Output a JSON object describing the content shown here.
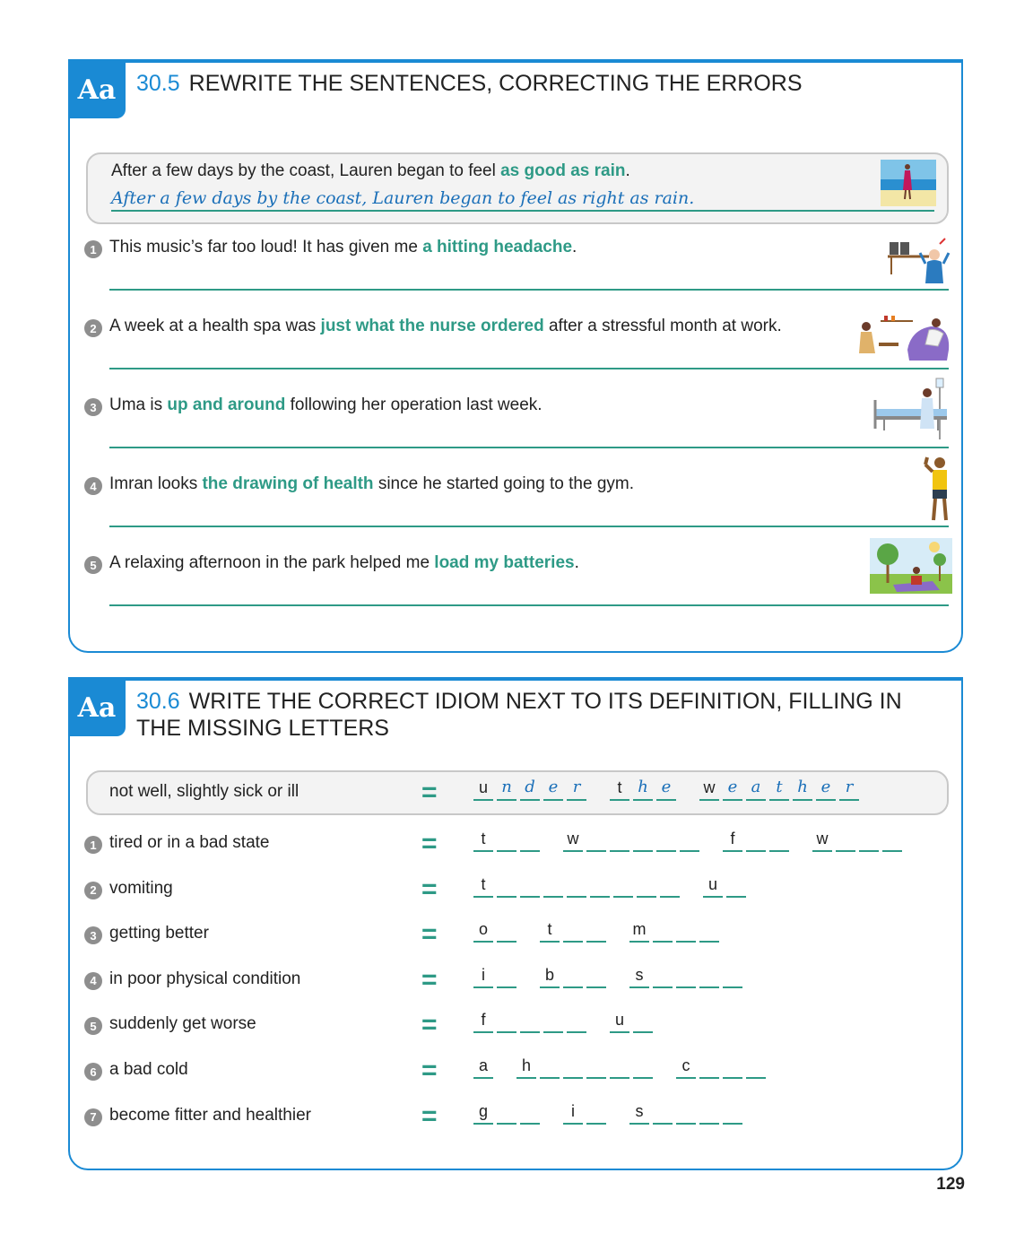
{
  "exercise1": {
    "badge": "Aa",
    "number": "30.5",
    "title": "REWRITE THE SENTENCES, CORRECTING THE ERRORS",
    "example": {
      "before": "After a few days by the coast, Lauren began to feel ",
      "highlight": "as good as rain",
      "after": ".",
      "answer": "After a few days by the coast, Lauren began to feel as right as rain."
    },
    "items": [
      {
        "num": "1",
        "before": "This music’s far too loud! It has given me ",
        "highlight": "a hitting headache",
        "after": "."
      },
      {
        "num": "2",
        "before": "A week at a health spa was ",
        "highlight": "just what the nurse ordered",
        "after": " after a stressful month at work."
      },
      {
        "num": "3",
        "before": "Uma is ",
        "highlight": "up and around",
        "after": " following her operation last week."
      },
      {
        "num": "4",
        "before": "Imran looks ",
        "highlight": "the drawing of health",
        "after": " since he started going to the gym."
      },
      {
        "num": "5",
        "before": "A relaxing afternoon in the park helped me ",
        "highlight": "load my batteries",
        "after": "."
      }
    ]
  },
  "exercise2": {
    "badge": "Aa",
    "number": "30.6",
    "title": "WRITE THE CORRECT IDIOM NEXT TO ITS DEFINITION, FILLING IN THE MISSING LETTERS",
    "equals": "=",
    "example": {
      "definition": "not well, slightly sick or ill",
      "words": [
        [
          {
            "c": "u",
            "h": false
          },
          {
            "c": "n",
            "h": true
          },
          {
            "c": "d",
            "h": true
          },
          {
            "c": "e",
            "h": true
          },
          {
            "c": "r",
            "h": true
          }
        ],
        [
          {
            "c": "t",
            "h": false
          },
          {
            "c": "h",
            "h": true
          },
          {
            "c": "e",
            "h": true
          }
        ],
        [
          {
            "c": "w",
            "h": false
          },
          {
            "c": "e",
            "h": true
          },
          {
            "c": "a",
            "h": true
          },
          {
            "c": "t",
            "h": true
          },
          {
            "c": "h",
            "h": true
          },
          {
            "c": "e",
            "h": true
          },
          {
            "c": "r",
            "h": true
          }
        ]
      ]
    },
    "items": [
      {
        "num": "1",
        "definition": "tired or in a bad state",
        "words": [
          [
            "t",
            "",
            ""
          ],
          [
            "w",
            "",
            "",
            "",
            "",
            ""
          ],
          [
            "f",
            "",
            ""
          ],
          [
            "w",
            "",
            "",
            ""
          ]
        ]
      },
      {
        "num": "2",
        "definition": "vomiting",
        "words": [
          [
            "t",
            "",
            "",
            "",
            "",
            "",
            "",
            "",
            ""
          ],
          [
            "u",
            ""
          ]
        ]
      },
      {
        "num": "3",
        "definition": "getting better",
        "words": [
          [
            "o",
            ""
          ],
          [
            "t",
            "",
            ""
          ],
          [
            "m",
            "",
            "",
            ""
          ]
        ]
      },
      {
        "num": "4",
        "definition": "in poor physical condition",
        "words": [
          [
            "i",
            ""
          ],
          [
            "b",
            "",
            ""
          ],
          [
            "s",
            "",
            "",
            "",
            ""
          ]
        ]
      },
      {
        "num": "5",
        "definition": "suddenly get worse",
        "words": [
          [
            "f",
            "",
            "",
            "",
            ""
          ],
          [
            "u",
            ""
          ]
        ]
      },
      {
        "num": "6",
        "definition": "a bad cold",
        "words": [
          [
            "a"
          ],
          [
            "h",
            "",
            "",
            "",
            "",
            ""
          ],
          [
            "c",
            "",
            "",
            ""
          ]
        ]
      },
      {
        "num": "7",
        "definition": "become fitter and healthier",
        "words": [
          [
            "g",
            "",
            ""
          ],
          [
            "i",
            ""
          ],
          [
            "s",
            "",
            "",
            "",
            ""
          ]
        ]
      }
    ]
  },
  "page_number": "129",
  "colors": {
    "accent_blue": "#1a8ad4",
    "highlight_green": "#2e9a86",
    "handwriting_blue": "#1a6fb8"
  }
}
